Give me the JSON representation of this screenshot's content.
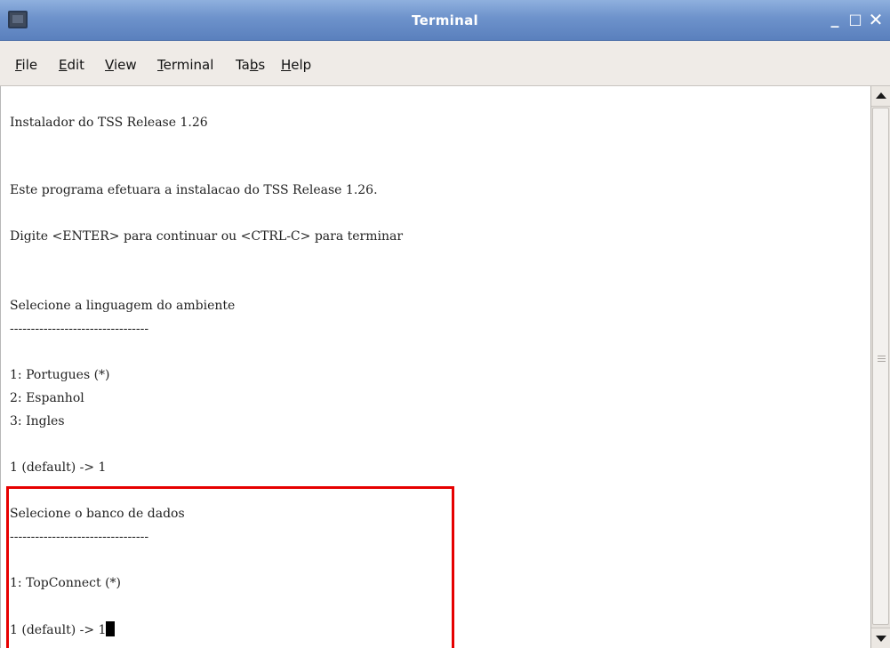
{
  "window": {
    "title": "Terminal"
  },
  "menu": [
    {
      "label": "File",
      "mnemonic": "F",
      "rest": "ile"
    },
    {
      "label": "Edit",
      "mnemonic": "E",
      "rest": "dit"
    },
    {
      "label": "View",
      "mnemonic": "V",
      "rest": "iew"
    },
    {
      "label": "Terminal",
      "mnemonic": "T",
      "rest": "erminal"
    },
    {
      "label": "Tabs",
      "pre": "Ta",
      "mnemonic": "b",
      "rest": "s"
    },
    {
      "label": "Help",
      "mnemonic": "H",
      "rest": "elp"
    }
  ],
  "terminal": {
    "lines": [
      "Instalador do TSS Release 1.26",
      "Este programa efetuara a instalacao do TSS Release 1.26.",
      "Digite <ENTER> para continuar ou <CTRL-C> para terminar",
      "Selecione a linguagem do ambiente",
      "---------------------------------",
      "1: Portugues (*)",
      "2: Espanhol",
      "3: Ingles",
      "1 (default) -> 1",
      "Selecione o banco de dados",
      "---------------------------------",
      "1: TopConnect (*)",
      "1 (default) -> 1"
    ]
  },
  "colors": {
    "highlight_border": "#e60000",
    "titlebar": "#6d92cb"
  },
  "icons": {
    "app": "terminal-icon",
    "minimize": "minimize-icon",
    "maximize": "maximize-icon",
    "close": "close-icon"
  }
}
